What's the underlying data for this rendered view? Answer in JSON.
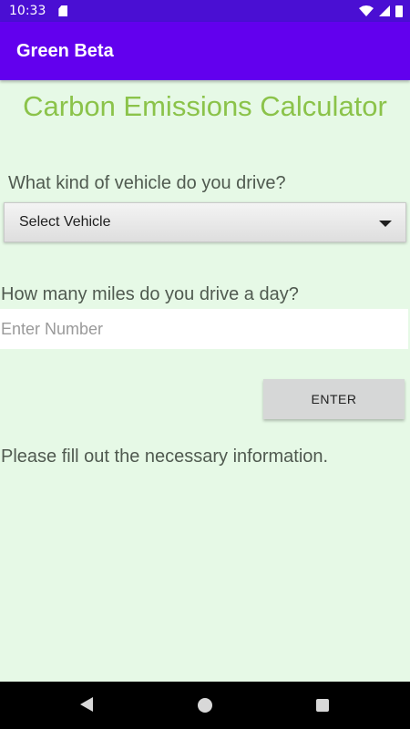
{
  "status_bar": {
    "time": "10:33",
    "background": "#4a0fd3",
    "icons": [
      "sd-card-icon",
      "wifi-icon",
      "cell-signal-icon",
      "battery-icon"
    ]
  },
  "app_bar": {
    "title": "Green Beta",
    "background": "#6200ee"
  },
  "main": {
    "title": "Carbon Emissions Calculator",
    "title_color": "#8bc34a",
    "background": "#e6f9e6",
    "vehicle_question": "What kind of vehicle do you drive?",
    "vehicle_select": {
      "selected": "Select Vehicle"
    },
    "miles_question": "How many miles do you drive a day?",
    "miles_input": {
      "value": "",
      "placeholder": "Enter Number"
    },
    "enter_button_label": "ENTER",
    "message": "Please fill out the necessary information."
  },
  "nav_bar": {
    "icons": [
      "back-icon",
      "home-icon",
      "recents-icon"
    ]
  }
}
